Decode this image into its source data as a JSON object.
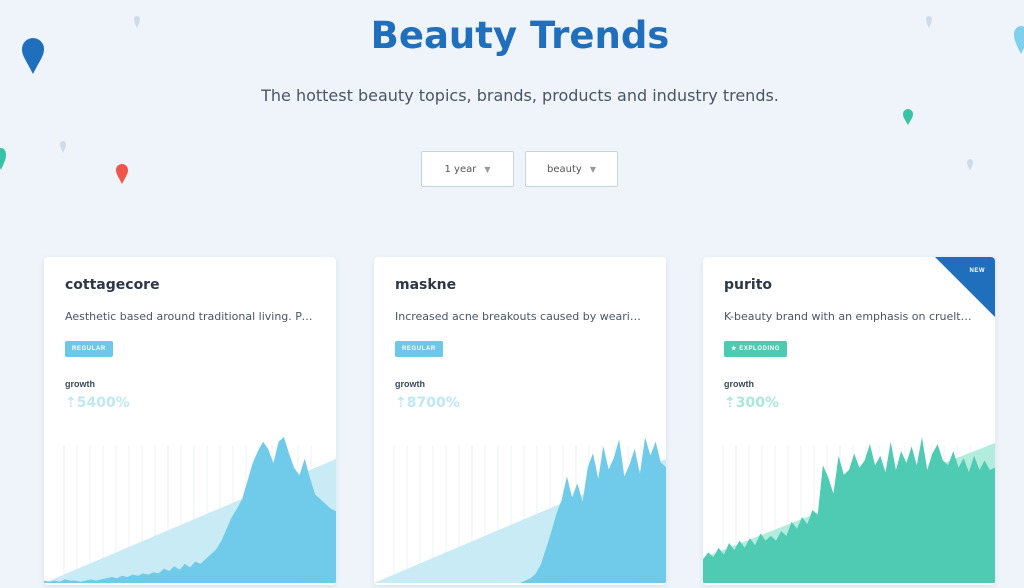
{
  "page": {
    "title": "Beauty Trends",
    "subtitle": "The hottest beauty topics, brands, products and industry trends."
  },
  "filters": {
    "period": "1 year",
    "category": "beauty",
    "caret": "▼"
  },
  "cards": [
    {
      "name": "cottagecore",
      "description": "Aesthetic based around traditional living. Popular among Gen Z.",
      "badge": "REGULAR",
      "badge_type": "regular",
      "growth_label": "growth",
      "growth_value": "⇡5400%",
      "accent": "#6fcbe9",
      "trend_color": "#c8ebf6",
      "is_new": false,
      "series": [
        2,
        1,
        2,
        1,
        3,
        2,
        2,
        1,
        2,
        3,
        2,
        3,
        4,
        5,
        4,
        6,
        5,
        7,
        6,
        8,
        7,
        9,
        8,
        12,
        10,
        14,
        11,
        16,
        13,
        18,
        16,
        20,
        24,
        28,
        35,
        45,
        55,
        62,
        70,
        85,
        100,
        110,
        118,
        112,
        100,
        118,
        122,
        108,
        96,
        90,
        104,
        88,
        74,
        70,
        66,
        62,
        60
      ]
    },
    {
      "name": "maskne",
      "description": "Increased acne breakouts caused by wearing a face mask.",
      "badge": "REGULAR",
      "badge_type": "regular",
      "growth_label": "growth",
      "growth_value": "⇡8700%",
      "accent": "#6fcbe9",
      "trend_color": "#c8ebf6",
      "is_new": false,
      "series": [
        0,
        0,
        0,
        0,
        0,
        0,
        0,
        0,
        0,
        0,
        0,
        0,
        0,
        0,
        0,
        0,
        0,
        0,
        0,
        0,
        0,
        0,
        0,
        0,
        0,
        0,
        0,
        0,
        0,
        2,
        4,
        8,
        16,
        30,
        44,
        60,
        72,
        92,
        74,
        86,
        70,
        100,
        112,
        90,
        118,
        98,
        108,
        124,
        92,
        102,
        116,
        94,
        126,
        110,
        122,
        104,
        100
      ]
    },
    {
      "name": "purito",
      "description": "K-beauty brand with an emphasis on cruelty-free, vegan products.",
      "badge": "EXPLODING",
      "badge_type": "exploding",
      "growth_label": "growth",
      "growth_value": "⇡300%",
      "accent": "#4fcbb3",
      "trend_color": "#b1ecdc",
      "is_new": true,
      "new_label": "NEW",
      "series": [
        20,
        26,
        22,
        30,
        24,
        34,
        28,
        36,
        30,
        38,
        32,
        42,
        36,
        40,
        36,
        44,
        40,
        52,
        46,
        56,
        50,
        62,
        58,
        100,
        90,
        76,
        108,
        92,
        96,
        110,
        98,
        104,
        118,
        100,
        108,
        94,
        120,
        96,
        112,
        102,
        116,
        100,
        124,
        96,
        110,
        118,
        104,
        100,
        112,
        98,
        106,
        94,
        108,
        96,
        104,
        96,
        98
      ]
    }
  ]
}
